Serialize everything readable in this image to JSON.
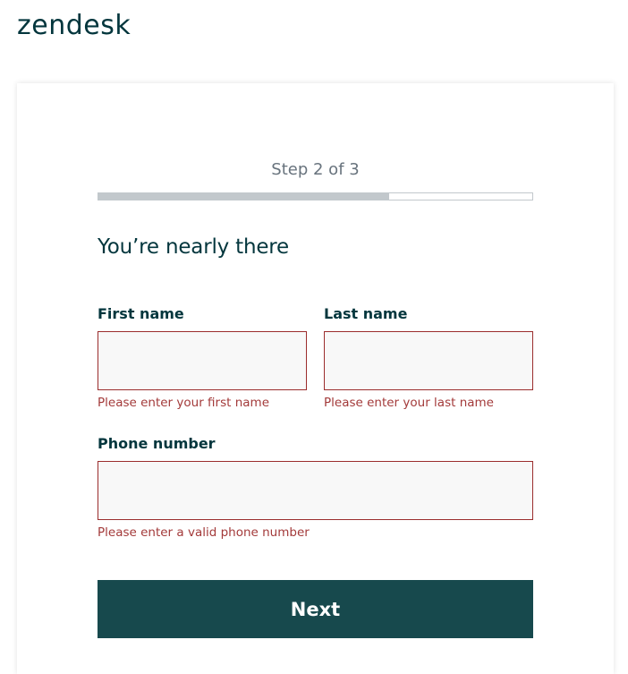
{
  "brand": {
    "logo_text": "zendesk"
  },
  "progress": {
    "step_label": "Step 2 of 3",
    "fraction": 0.67
  },
  "form": {
    "heading": "You’re nearly there",
    "first_name": {
      "label": "First name",
      "value": "",
      "error": "Please enter your first name"
    },
    "last_name": {
      "label": "Last name",
      "value": "",
      "error": "Please enter your last name"
    },
    "phone": {
      "label": "Phone number",
      "value": "",
      "error": "Please enter a valid phone number"
    },
    "next_label": "Next"
  },
  "colors": {
    "brand_dark": "#03363d",
    "button_bg": "#17494d",
    "error": "#a33a3a",
    "input_border_error": "#9b2d2d"
  }
}
